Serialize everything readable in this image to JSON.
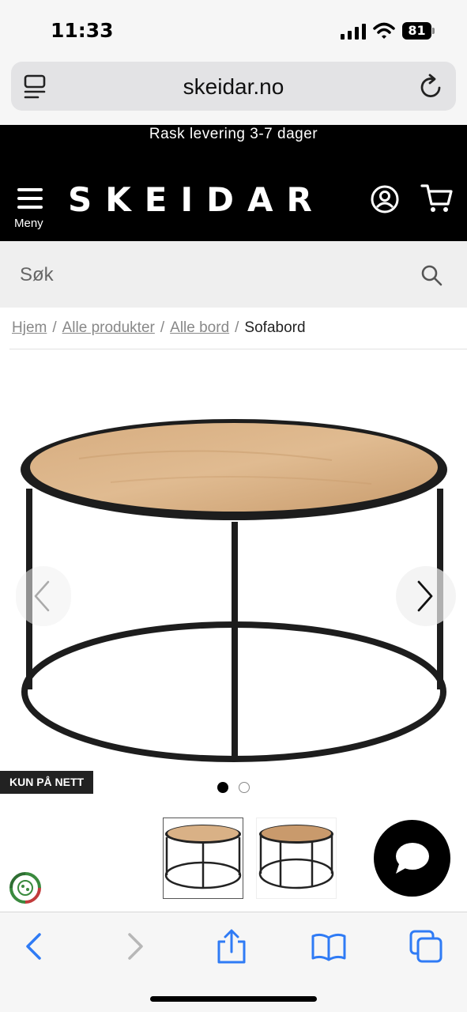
{
  "status_bar": {
    "time": "11:33",
    "battery": "81"
  },
  "browser": {
    "url": "skeidar.no",
    "toolbar_icons": [
      "back-icon",
      "forward-icon",
      "share-icon",
      "bookmarks-icon",
      "tabs-icon"
    ]
  },
  "site": {
    "promo": "Rask levering 3-7 dager",
    "menu_label": "Meny",
    "logo": "SKEIDAR"
  },
  "search": {
    "placeholder": "Søk"
  },
  "breadcrumb": {
    "items": [
      "Hjem",
      "Alle produkter",
      "Alle bord"
    ],
    "current": "Sofabord"
  },
  "gallery": {
    "badge": "KUN PÅ NETT",
    "image_count": 2,
    "active_index": 0
  },
  "colors": {
    "header_bg": "#000000",
    "search_bg": "#efefef",
    "accent_blue": "#2f7bf5",
    "wood": "#d9b186",
    "eco_green": "#3a8a3e"
  }
}
